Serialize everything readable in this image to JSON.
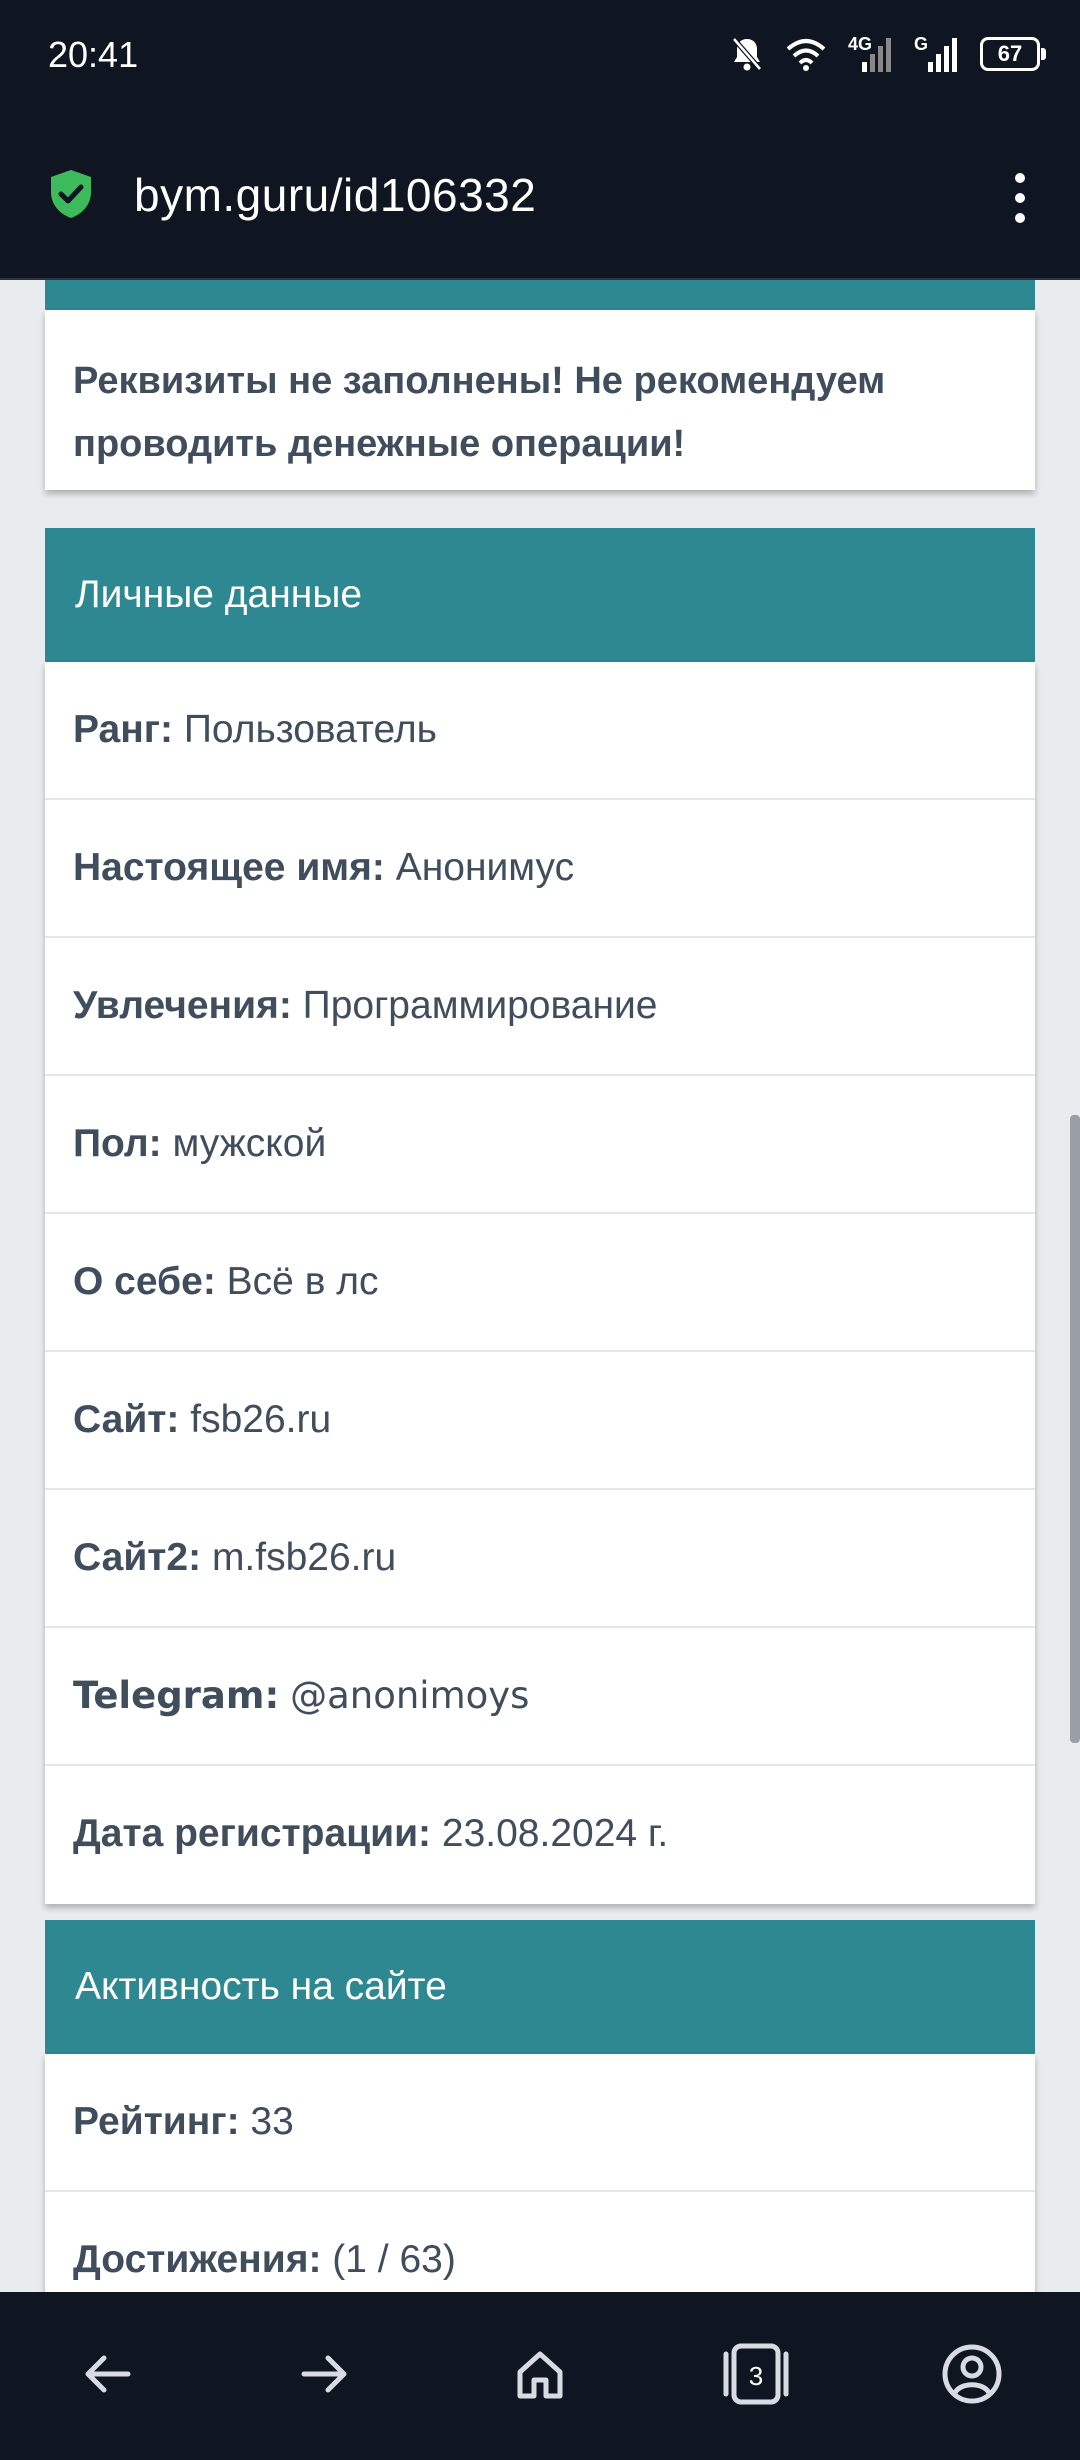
{
  "status_bar": {
    "time": "20:41",
    "network_4g": "4G",
    "network_g": "G",
    "battery": "67",
    "icons": [
      "bell-off-icon",
      "wifi-icon",
      "signal-4g-icon",
      "signal-g-icon",
      "battery-icon"
    ]
  },
  "browser": {
    "url": "bym.guru/id106332",
    "secure_icon": "shield-check-icon",
    "menu_icon": "more-vertical-icon"
  },
  "warning": {
    "text": "Реквизиты не заполнены! Не рекомендуем проводить денежные операции!"
  },
  "personal": {
    "title": "Личные данные",
    "rows": [
      {
        "label": "Ранг:",
        "value": "Пользователь"
      },
      {
        "label": "Настоящее имя:",
        "value": "Анонимус"
      },
      {
        "label": "Увлечения:",
        "value": "Программирование"
      },
      {
        "label": "Пол:",
        "value": "мужской"
      },
      {
        "label": "О себе:",
        "value": "Всё в лс"
      },
      {
        "label": "Сайт:",
        "value": "fsb26.ru"
      },
      {
        "label": "Сайт2:",
        "value": "m.fsb26.ru"
      },
      {
        "label": "Telegram:",
        "value": "@anonimoys"
      },
      {
        "label": "Дата регистрации:",
        "value": "23.08.2024 г."
      }
    ]
  },
  "activity": {
    "title": "Активность на сайте",
    "rows": [
      {
        "label": "Рейтинг:",
        "value": "33"
      },
      {
        "label": "Достижения:",
        "value": "(1 / 63)"
      }
    ]
  },
  "bottom_nav": {
    "tab_count": "3",
    "icons": [
      "back-arrow-icon",
      "forward-arrow-icon",
      "home-icon",
      "tabs-icon",
      "account-icon"
    ]
  },
  "colors": {
    "accent": "#2e8891",
    "chrome": "#0f1621",
    "text": "#3f4d5c",
    "secure": "#3dba5c"
  }
}
